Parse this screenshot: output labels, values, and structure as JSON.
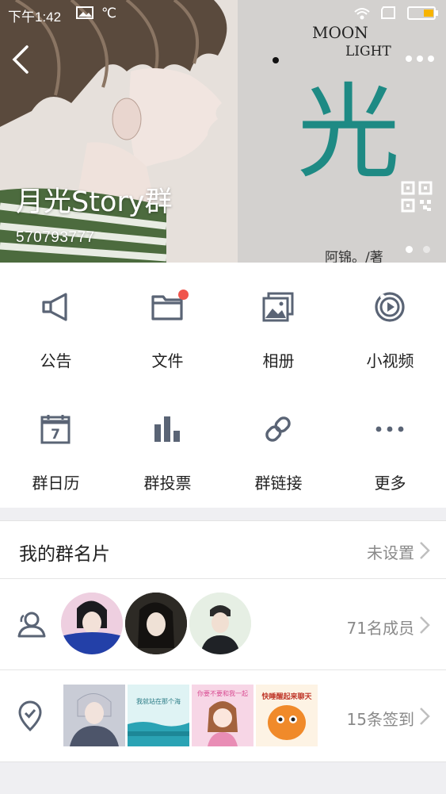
{
  "status": {
    "time": "下午1:42",
    "weather_icon": "temp-icon",
    "weather_text": "℃"
  },
  "header": {
    "group_name": "月光Story群",
    "group_id": "570793777",
    "cover": {
      "title_line1": "MOON",
      "title_line2": "LIGHT",
      "big_char": "光",
      "author": "阿锦。/著"
    },
    "page_indicator": {
      "count": 2,
      "active": 0
    }
  },
  "features": [
    {
      "label": "公告",
      "icon": "megaphone-icon"
    },
    {
      "label": "文件",
      "icon": "folder-icon",
      "badge": true
    },
    {
      "label": "相册",
      "icon": "album-icon"
    },
    {
      "label": "小视频",
      "icon": "video-icon"
    },
    {
      "label": "群日历",
      "icon": "calendar-icon",
      "calendar_day": "7"
    },
    {
      "label": "群投票",
      "icon": "bar-chart-icon"
    },
    {
      "label": "群链接",
      "icon": "link-icon"
    },
    {
      "label": "更多",
      "icon": "more-icon"
    }
  ],
  "my_card": {
    "title": "我的群名片",
    "value": "未设置"
  },
  "members": {
    "count_text": "71名成员",
    "avatars": [
      "member-avatar-1",
      "member-avatar-2",
      "member-avatar-3"
    ]
  },
  "checkins": {
    "count_text": "15条签到",
    "thumbs": [
      {
        "caption": ""
      },
      {
        "caption": "我就站在那个海"
      },
      {
        "caption": "你要不要和我一起"
      },
      {
        "caption": "快睡醒起来聊天"
      }
    ]
  },
  "colors": {
    "accent_badge": "#f0554c",
    "icon_gray": "#5a6475",
    "value_gray": "#8a8a8a"
  }
}
